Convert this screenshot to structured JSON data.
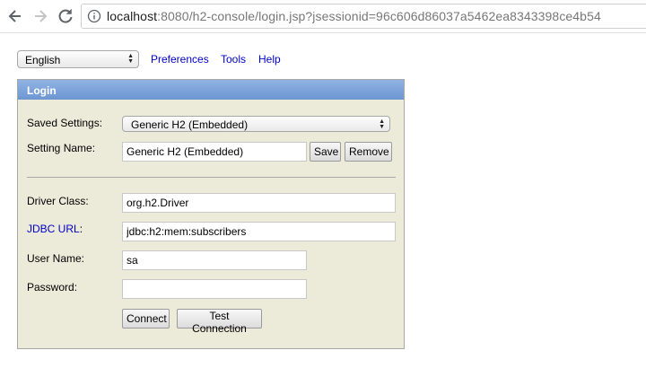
{
  "browser": {
    "url_host": "localhost",
    "url_rest": ":8080/h2-console/login.jsp?jsessionid=96c606d86037a5462ea8343398ce4b54"
  },
  "toolbar": {
    "language": "English",
    "links": [
      "Preferences",
      "Tools",
      "Help"
    ]
  },
  "login": {
    "title": "Login",
    "saved_settings_label": "Saved Settings:",
    "saved_settings_value": "Generic H2 (Embedded)",
    "setting_name_label": "Setting Name:",
    "setting_name_value": "Generic H2 (Embedded)",
    "save_label": "Save",
    "remove_label": "Remove",
    "driver_class_label": "Driver Class:",
    "driver_class_value": "org.h2.Driver",
    "jdbc_url_link": "JDBC URL",
    "jdbc_url_colon": ":",
    "jdbc_url_value": "jdbc:h2:mem:subscribers",
    "user_name_label": "User Name:",
    "user_name_value": "sa",
    "password_label": "Password:",
    "password_value": "",
    "connect_label": "Connect",
    "test_connection_label": "Test Connection"
  },
  "colors": {
    "panel_bg": "#ecead9",
    "header_bg": "#7ba2da",
    "link": "#0000cc"
  }
}
